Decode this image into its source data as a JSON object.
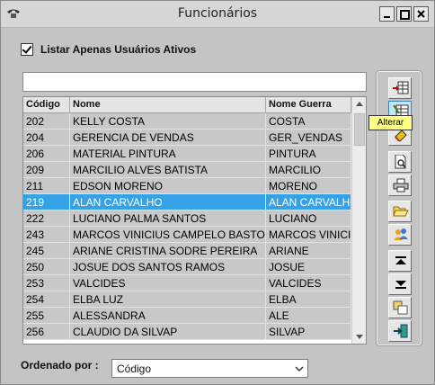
{
  "window": {
    "title": "Funcionários"
  },
  "filter": {
    "active_only_label": "Listar Apenas Usuários Ativos",
    "active_only_checked": true
  },
  "search": {
    "value": ""
  },
  "table": {
    "columns": [
      "Código",
      "Nome",
      "Nome Guerra"
    ],
    "rows": [
      [
        "202",
        "KELLY COSTA",
        "COSTA"
      ],
      [
        "204",
        "GERENCIA DE VENDAS",
        "GER_VENDAS"
      ],
      [
        "206",
        "MATERIAL PINTURA",
        "PINTURA"
      ],
      [
        "209",
        "MARCILIO ALVES BATISTA",
        "MARCILIO"
      ],
      [
        "211",
        "EDSON MORENO",
        "MORENO"
      ],
      [
        "219",
        "ALAN CARVALHO",
        "ALAN CARVALHO"
      ],
      [
        "222",
        "LUCIANO PALMA SANTOS",
        "LUCIANO"
      ],
      [
        "243",
        "MARCOS VINICIUS CAMPELO BASTOS",
        "MARCOS VINICIUS"
      ],
      [
        "245",
        "ARIANE CRISTINA SODRE PEREIRA",
        "ARIANE"
      ],
      [
        "250",
        "JOSUE DOS SANTOS RAMOS",
        "JOSUE"
      ],
      [
        "253",
        "VALCIDES",
        "VALCIDES"
      ],
      [
        "254",
        "ELBA LUZ",
        "ELBA"
      ],
      [
        "255",
        "ALESSANDRA",
        "ALE"
      ],
      [
        "256",
        "CLAUDIO DA SILVAP",
        "SILVAP"
      ]
    ],
    "selected_index": 5
  },
  "toolbar": {
    "buttons": [
      {
        "name": "incluir-button",
        "icon": "table-add-icon"
      },
      {
        "name": "alterar-button",
        "icon": "table-edit-icon"
      },
      {
        "name": "excluir-button",
        "icon": "eraser-icon"
      },
      {
        "name": "visualizar-button",
        "icon": "print-preview-icon"
      },
      {
        "name": "imprimir-button",
        "icon": "printer-icon"
      },
      {
        "name": "abrir-button",
        "icon": "folder-open-icon"
      },
      {
        "name": "usuarios-button",
        "icon": "users-icon"
      },
      {
        "name": "primeiro-button",
        "icon": "move-first-icon"
      },
      {
        "name": "ultimo-button",
        "icon": "move-last-icon"
      },
      {
        "name": "copiar-button",
        "icon": "copy-icon"
      },
      {
        "name": "sair-button",
        "icon": "exit-door-icon"
      }
    ],
    "tooltip": "Alterar"
  },
  "order": {
    "label": "Ordenado por :",
    "value": "Código"
  },
  "colors": {
    "selection": "#35a2e8",
    "row_bg": "#c8c8c8",
    "tooltip_bg": "#ffff80"
  }
}
